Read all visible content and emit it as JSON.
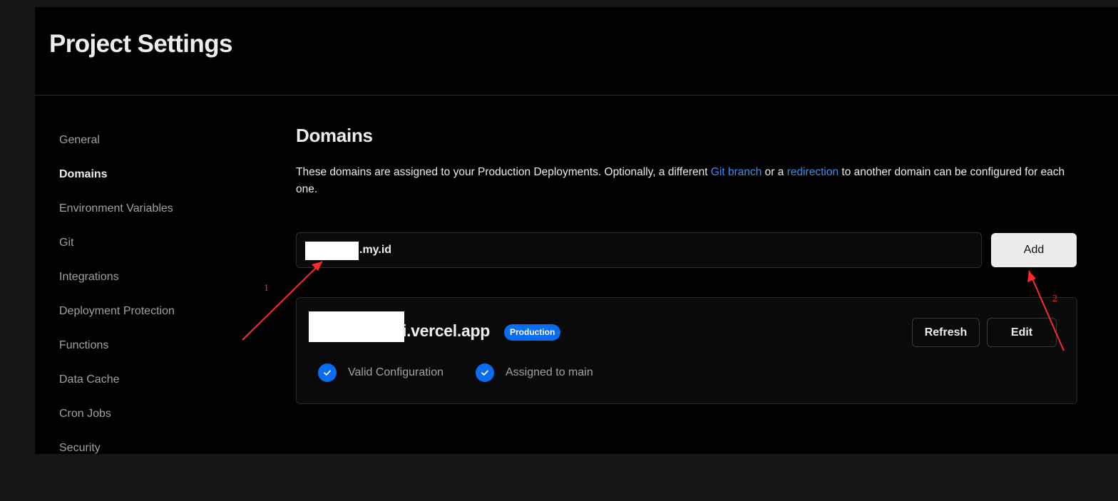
{
  "header": {
    "title": "Project Settings"
  },
  "sidebar": {
    "items": [
      {
        "label": "General"
      },
      {
        "label": "Domains",
        "active": true
      },
      {
        "label": "Environment Variables"
      },
      {
        "label": "Git"
      },
      {
        "label": "Integrations"
      },
      {
        "label": "Deployment Protection"
      },
      {
        "label": "Functions"
      },
      {
        "label": "Data Cache"
      },
      {
        "label": "Cron Jobs"
      },
      {
        "label": "Security"
      }
    ]
  },
  "main": {
    "title": "Domains",
    "description": {
      "part1": "These domains are assigned to your Production Deployments. Optionally, a different ",
      "link1": "Git branch",
      "part2": " or a ",
      "link2": "redirection",
      "part3": " to another domain can be configured for each one."
    },
    "domain_input_value": ".my.id",
    "add_label": "Add",
    "domain_card": {
      "domain": "i.vercel.app",
      "badge": "Production",
      "refresh_label": "Refresh",
      "edit_label": "Edit",
      "status_1": "Valid Configuration",
      "status_2": "Assigned to main"
    }
  },
  "annotations": {
    "label_1": "1",
    "label_2": "2",
    "color": "#ff2a2a"
  },
  "colors": {
    "page_background": "#000000",
    "outer_background": "#161616",
    "accent_blue": "#0a6cf0",
    "link_blue": "#3b8eea"
  }
}
